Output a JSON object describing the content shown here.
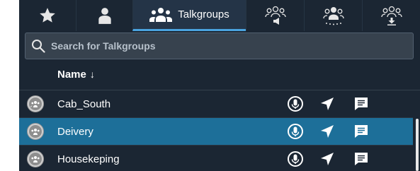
{
  "tabs": [
    {
      "icon": "star-icon",
      "label": ""
    },
    {
      "icon": "person-icon",
      "label": ""
    },
    {
      "icon": "group-icon",
      "label": "Talkgroups",
      "active": true
    },
    {
      "icon": "group-broadcast-icon",
      "label": ""
    },
    {
      "icon": "group-scan-icon",
      "label": ""
    },
    {
      "icon": "group-download-icon",
      "label": ""
    }
  ],
  "search": {
    "placeholder": "Search for Talkgroups",
    "value": ""
  },
  "list": {
    "column_header": "Name",
    "sort_indicator": "↓",
    "rows": [
      {
        "name": "Cab_South",
        "selected": false
      },
      {
        "name": "Deivery",
        "selected": true
      },
      {
        "name": "Housekeping",
        "selected": false
      }
    ]
  },
  "colors": {
    "background": "#1b2633",
    "selected_row": "#1d6f99",
    "active_tab_underline": "#4aa3df"
  }
}
